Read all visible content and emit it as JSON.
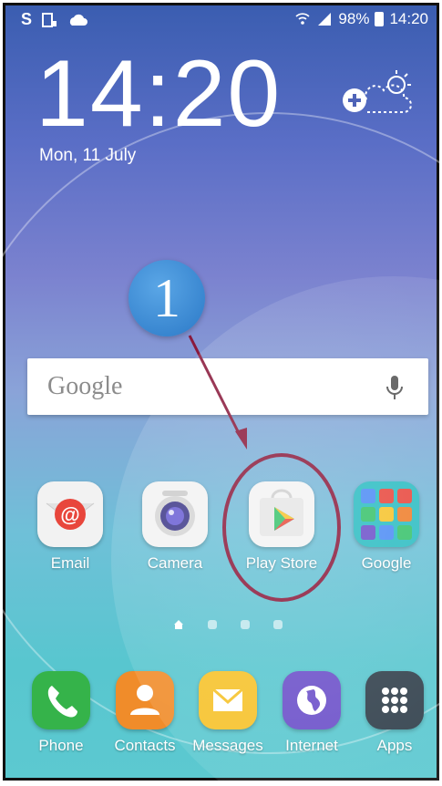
{
  "status_bar": {
    "left_icons": [
      "s-icon",
      "screenshot-icon",
      "cloud-icon"
    ],
    "left_s": "S",
    "battery": "98%",
    "time": "14:20"
  },
  "lockscreen": {
    "clock": "14:20",
    "date": "Mon, 11 July"
  },
  "annotation": {
    "step": "1"
  },
  "search": {
    "label": "Google"
  },
  "apps": [
    {
      "label": "Email",
      "icon": "email-icon",
      "color": "#f5f5f5"
    },
    {
      "label": "Camera",
      "icon": "camera-icon",
      "color": "#f5f5f5"
    },
    {
      "label": "Play Store",
      "icon": "play-store-icon",
      "color": "#f5f5f5"
    },
    {
      "label": "Google",
      "icon": "google-folder-icon",
      "color": "#2bbcc2"
    }
  ],
  "dock": [
    {
      "label": "Phone",
      "icon": "phone-icon",
      "color": "#35b34a"
    },
    {
      "label": "Contacts",
      "icon": "contacts-icon",
      "color": "#f08c2a"
    },
    {
      "label": "Messages",
      "icon": "messages-icon",
      "color": "#f6c22a"
    },
    {
      "label": "Internet",
      "icon": "internet-icon",
      "color": "#6b4fc9"
    },
    {
      "label": "Apps",
      "icon": "apps-grid-icon",
      "color": "#2f3e4a"
    }
  ],
  "colors": {
    "annotation_oval": "#8a1a3c",
    "badge": "#3b8ad6"
  }
}
